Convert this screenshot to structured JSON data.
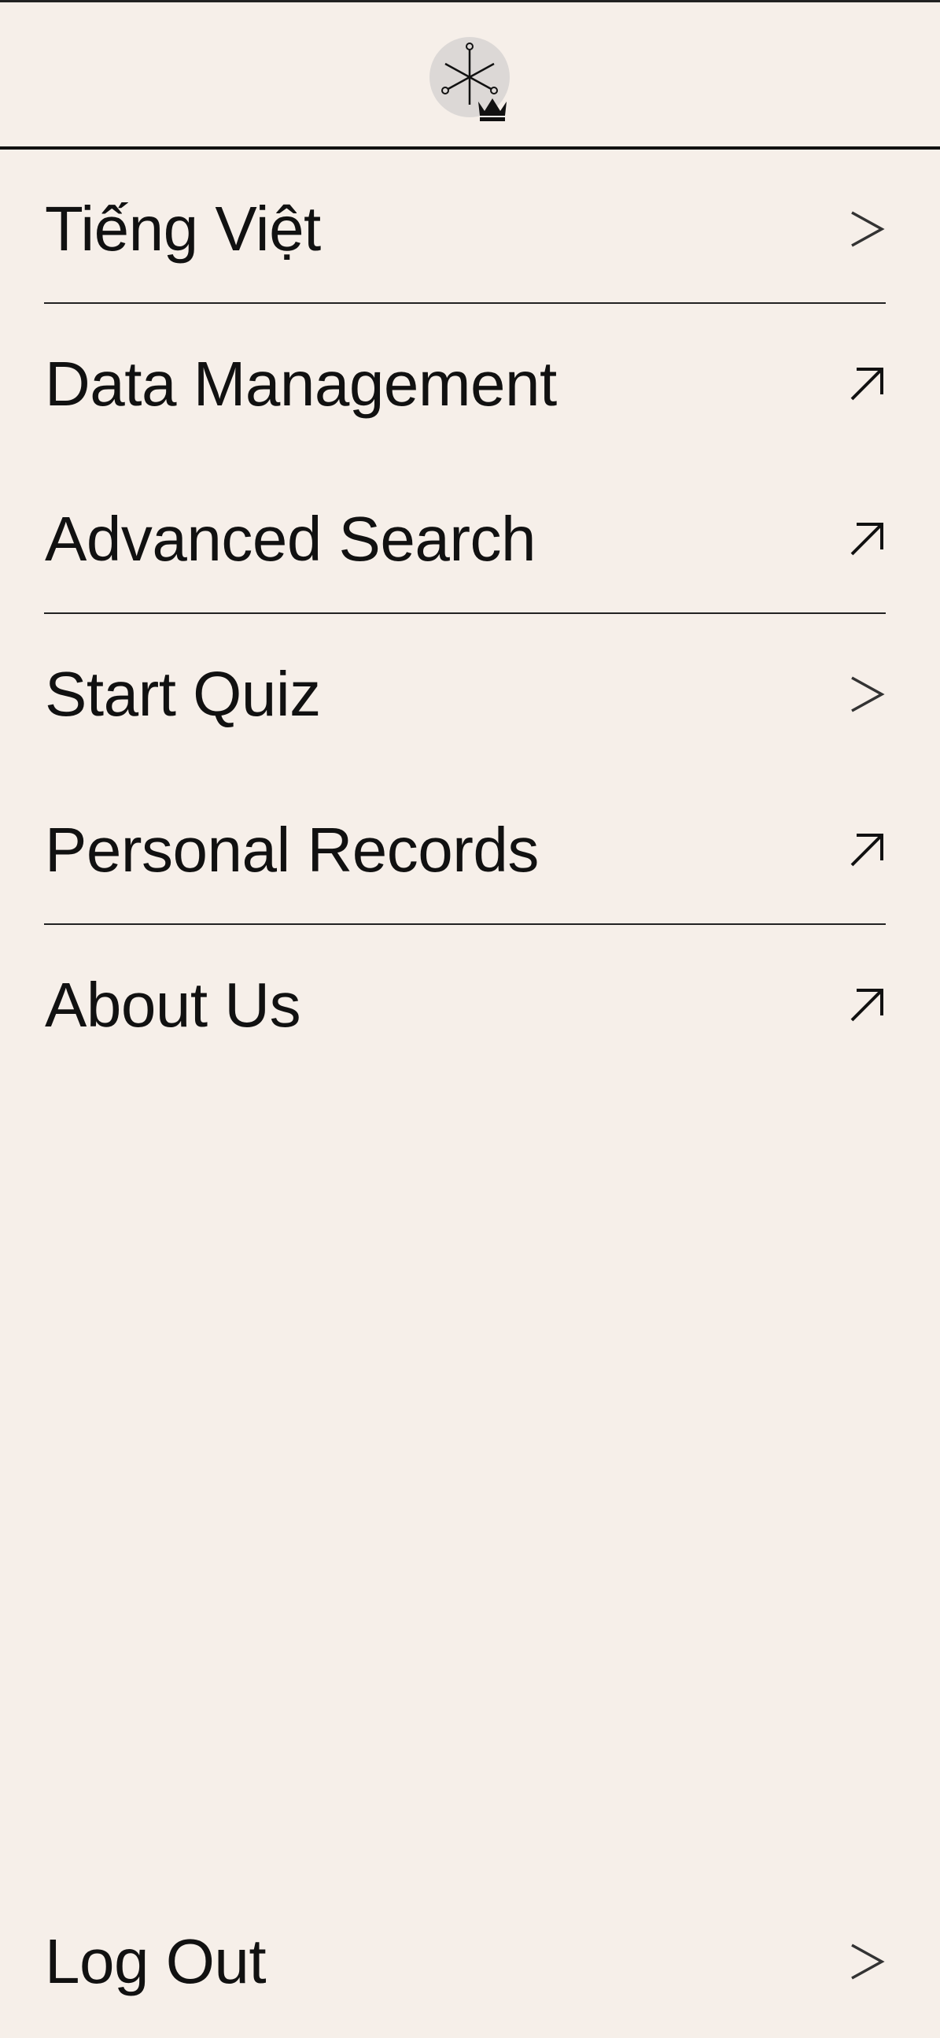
{
  "menu": {
    "items": [
      {
        "label": "Tiếng Việt",
        "icon": "chevron-right-icon"
      },
      {
        "label": "Data Management",
        "icon": "external-link-arrow-icon"
      },
      {
        "label": "Advanced Search",
        "icon": "external-link-arrow-icon"
      },
      {
        "label": "Start Quiz",
        "icon": "chevron-right-icon"
      },
      {
        "label": "Personal Records",
        "icon": "external-link-arrow-icon"
      },
      {
        "label": "About Us",
        "icon": "external-link-arrow-icon"
      }
    ]
  },
  "footer": {
    "logout_label": "Log Out",
    "logout_icon": "chevron-right-icon"
  },
  "colors": {
    "background": "#f6efe9",
    "text": "#111111",
    "avatar_bg": "#dcd8d6"
  }
}
